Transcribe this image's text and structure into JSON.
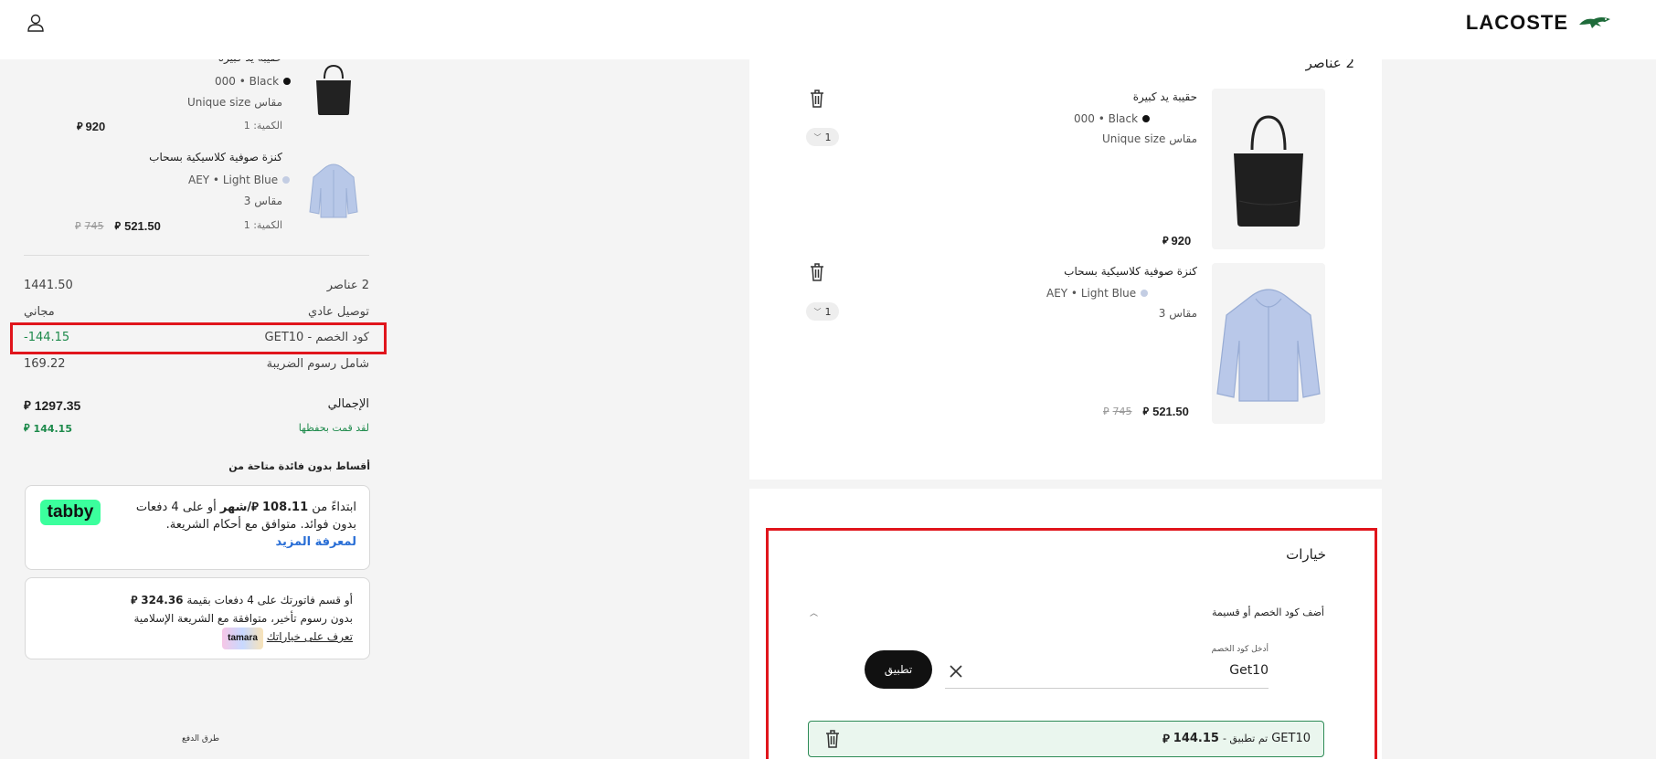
{
  "header": {
    "brand": "LACOSTE"
  },
  "summary": {
    "items": [
      {
        "name": "حقيبة يد كبيرة",
        "color": "000 • Black",
        "size": "مقاس Unique size",
        "qty": "الكمية: 1",
        "price": "920",
        "old_price": ""
      },
      {
        "name": "كنزة صوفية كلاسيكية بسحاب",
        "color": "AEY • Light Blue",
        "size": "مقاس 3",
        "qty": "الكمية: 1",
        "price": "521.50",
        "old_price": "745"
      }
    ],
    "subtotal_label": "2 عناصر",
    "subtotal_value": "1441.50",
    "shipping_label": "توصيل عادي",
    "shipping_value": "مجاني",
    "discount_label": "كود الخصم - GET10",
    "discount_value": "-144.15",
    "tax_label": "شامل رسوم الضريبة",
    "tax_value": "169.22",
    "total_label": "الإجمالي",
    "total_value": "1297.35",
    "saved_label": "لقد قمت بحفظها",
    "saved_value": "144.15",
    "installments_title": "أقساط بدون فائدة متاحة من",
    "tabby": {
      "logo": "tabby",
      "line1_prefix": "ابتداءً من",
      "amount": "108.11",
      "per_month": "/شهر",
      "line1_suffix": "أو على 4 دفعات بدون",
      "line2": "فوائد. متوافق مع أحكام الشريعة.",
      "link": "لمعرفة المزيد"
    },
    "tamara": {
      "logo": "tamara",
      "line1_prefix": "أو قسم فاتورتك على 4 دفعات بقيمة",
      "amount": "324.36",
      "line2": "بدون رسوم تأخير، متوافقة مع الشريعة الإسلامية",
      "link": "تعرف على خياراتك"
    },
    "payment_methods": "طرق الدفع"
  },
  "cart": {
    "title": "2 عناصر",
    "items": [
      {
        "name": "حقيبة يد كبيرة",
        "color": "000 • Black",
        "size": "مقاس Unique size",
        "qty": "1",
        "price": "920",
        "old_price": ""
      },
      {
        "name": "كنزة صوفية كلاسيكية بسحاب",
        "color": "AEY • Light Blue",
        "size": "مقاس 3",
        "qty": "1",
        "price": "521.50",
        "old_price": "745"
      }
    ]
  },
  "options": {
    "title": "خيارات",
    "promo_toggle": "أضف كود الخصم أو قسيمة",
    "field_label": "أدخل كود الخصم",
    "field_value": "Get10",
    "apply": "تطبيق",
    "applied_code": "GET10",
    "applied_text": "تم تطبيق -",
    "applied_amount": "144.15"
  },
  "colors": {
    "red_highlight": "#e0151c",
    "green": "#1d8a4b",
    "tabby_green": "#3bff9d",
    "dark": "#111111",
    "panel_grey": "#f4f4f4"
  }
}
